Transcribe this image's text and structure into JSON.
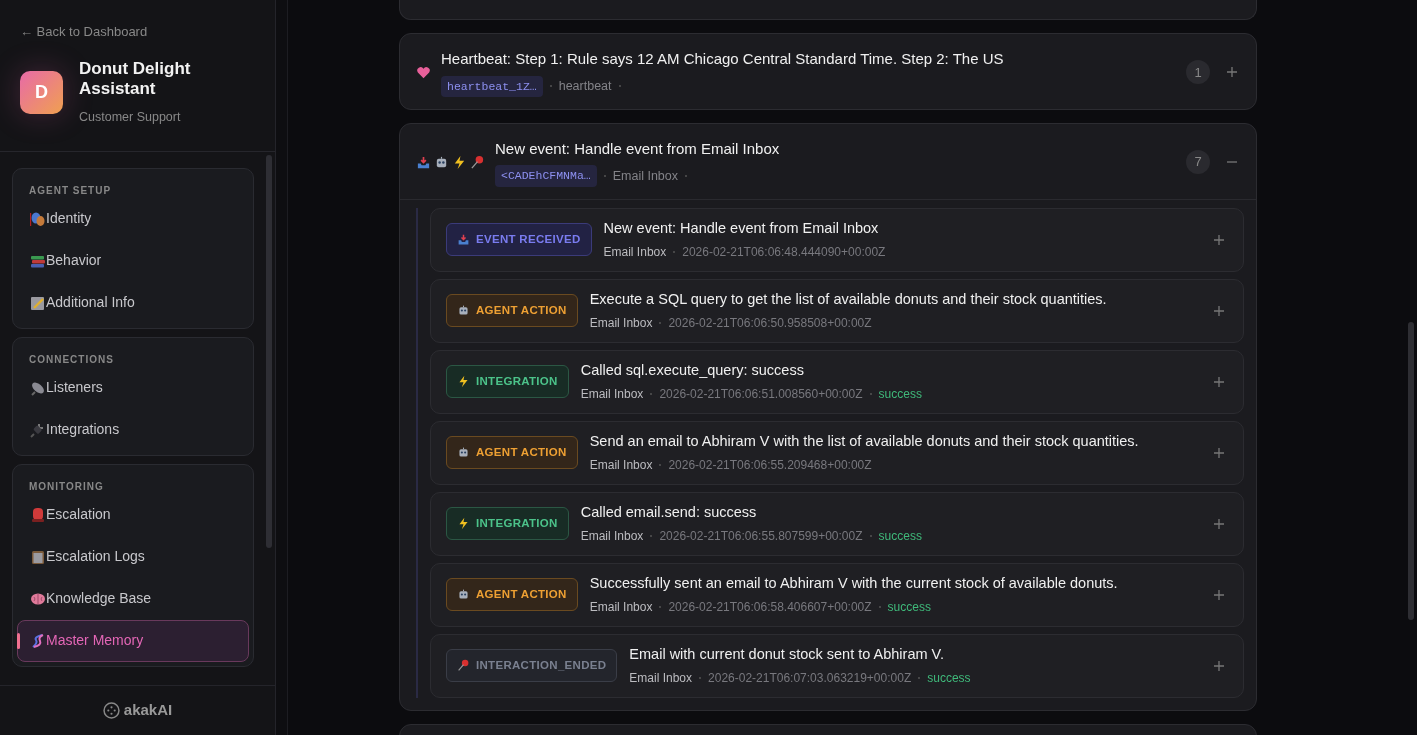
{
  "back_link": "← Back to Dashboard",
  "agent": {
    "initial": "D",
    "name": "Donut Delight Assistant",
    "subtitle": "Customer Support"
  },
  "sidebar": {
    "sections": [
      {
        "title": "AGENT SETUP",
        "items": [
          {
            "label": "Identity",
            "selected": false
          },
          {
            "label": "Behavior",
            "selected": false
          },
          {
            "label": "Additional Info",
            "selected": false
          }
        ]
      },
      {
        "title": "CONNECTIONS",
        "items": [
          {
            "label": "Listeners",
            "selected": false
          },
          {
            "label": "Integrations",
            "selected": false
          }
        ]
      },
      {
        "title": "MONITORING",
        "items": [
          {
            "label": "Escalation",
            "selected": false
          },
          {
            "label": "Escalation Logs",
            "selected": false
          },
          {
            "label": "Knowledge Base",
            "selected": false
          },
          {
            "label": "Master Memory",
            "selected": true
          }
        ]
      }
    ]
  },
  "footer_logo": "akakAI",
  "groups": [
    {
      "title": "Heartbeat: Step 1: Rule says 12 AM Chicago Central Standard Time. Step 2: The US",
      "kind": "heartbeat",
      "tag": "heartbeat_1Z…",
      "source": "heartbeat",
      "count": "1",
      "expanded": false
    },
    {
      "title": "New event: Handle event from Email Inbox",
      "kind": "interaction",
      "tag": "<CADEhCFMNMa…",
      "source": "Email Inbox",
      "count": "7",
      "expanded": true,
      "events": [
        {
          "kind": "event",
          "label": "EVENT RECEIVED",
          "title": "New event: Handle event from Email Inbox",
          "source": "Email Inbox",
          "timestamp": "2026-02-21T06:06:48.444090+00:00Z",
          "expanded": false
        },
        {
          "kind": "agent",
          "label": "AGENT ACTION",
          "title": "Execute a SQL query to get the list of available donuts and their stock quantities.",
          "source": "Email Inbox",
          "timestamp": "2026-02-21T06:06:50.958508+00:00Z",
          "expanded": false
        },
        {
          "kind": "integration",
          "label": "INTEGRATION",
          "title": "Called sql.execute_query: success",
          "source": "Email Inbox",
          "timestamp": "2026-02-21T06:06:51.008560+00:00Z",
          "status": "success",
          "expanded": false
        },
        {
          "kind": "agent",
          "label": "AGENT ACTION",
          "title": "Send an email to Abhiram V with the list of available donuts and their stock quantities.",
          "source": "Email Inbox",
          "timestamp": "2026-02-21T06:06:55.209468+00:00Z",
          "expanded": false
        },
        {
          "kind": "integration",
          "label": "INTEGRATION",
          "title": "Called email.send: success",
          "source": "Email Inbox",
          "timestamp": "2026-02-21T06:06:55.807599+00:00Z",
          "status": "success",
          "expanded": false
        },
        {
          "kind": "agent",
          "label": "AGENT ACTION",
          "title": "Successfully sent an email to Abhiram V with the current stock of available donuts.",
          "source": "Email Inbox",
          "timestamp": "2026-02-21T06:06:58.406607+00:00Z",
          "status": "success",
          "expanded": false
        },
        {
          "kind": "ended",
          "label": "INTERACTION_ENDED",
          "title": "Email with current donut stock sent to Abhiram V.",
          "source": "Email Inbox",
          "timestamp": "2026-02-21T06:07:03.063219+00:00Z",
          "status": "success",
          "expanded": false
        }
      ]
    }
  ]
}
